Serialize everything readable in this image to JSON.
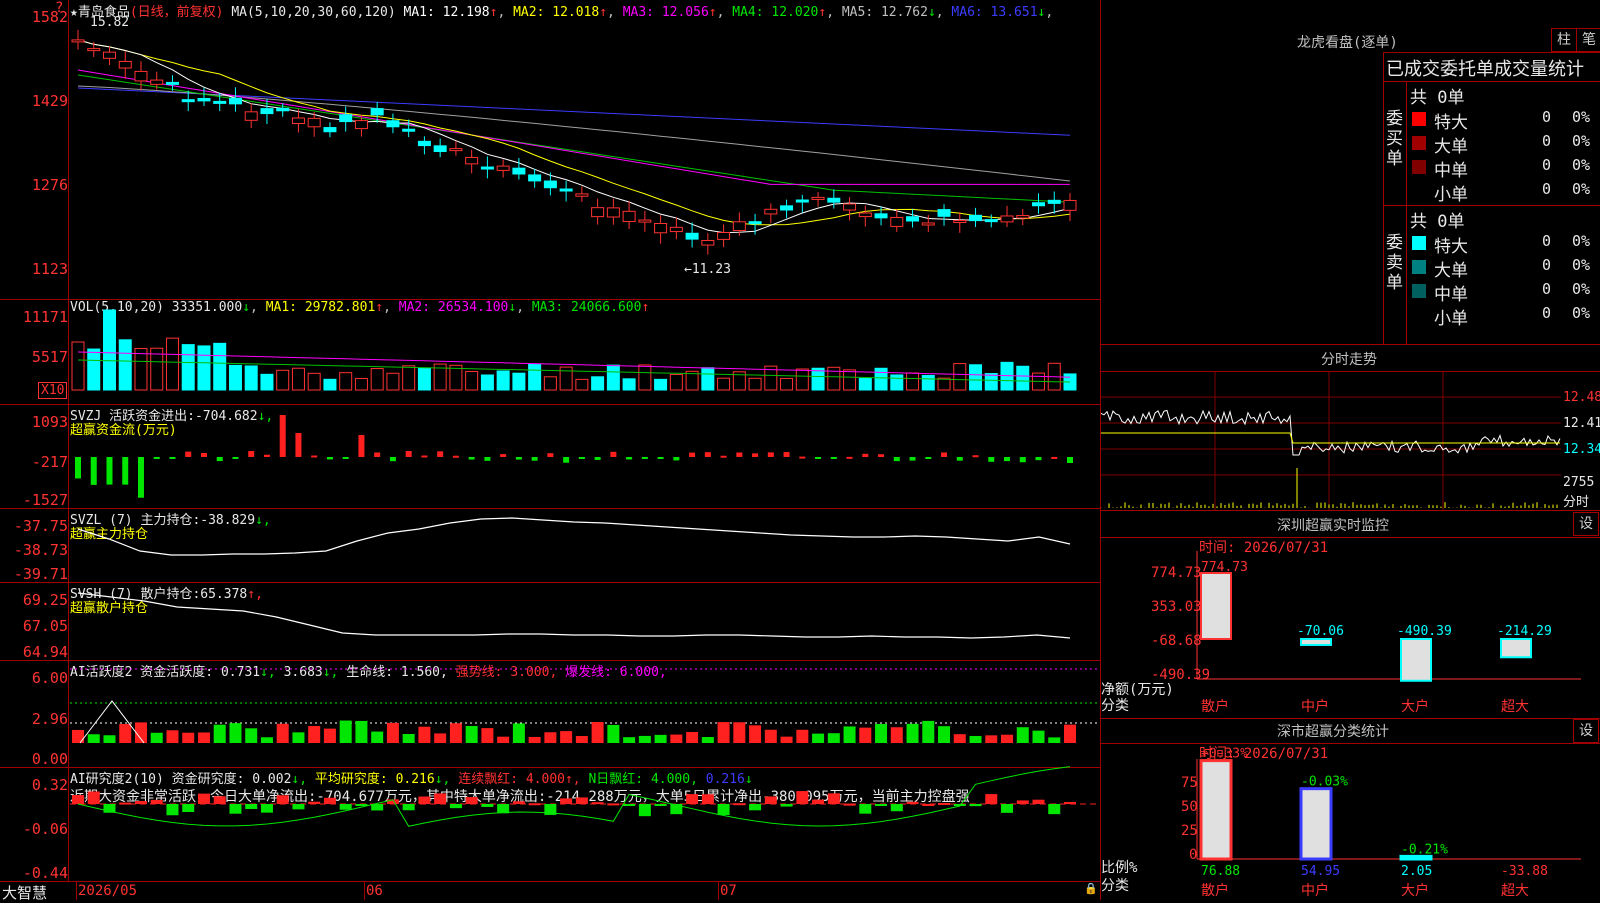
{
  "stock": {
    "star": "★",
    "name": "青岛食品",
    "mode": "(日线，前复权)",
    "ma_label": "MA(5,10,20,30,60,120)",
    "ma": [
      {
        "k": "MA1:",
        "v": "12.198",
        "c": "#ffffff"
      },
      {
        "k": "MA2:",
        "v": "12.018",
        "c": "#ffff00"
      },
      {
        "k": "MA3:",
        "v": "12.056",
        "c": "#ff00ff"
      },
      {
        "k": "MA4:",
        "v": "12.020",
        "c": "#00e600"
      },
      {
        "k": "MA5:",
        "v": "12.762",
        "c": "#c0c0c0"
      },
      {
        "k": "MA6:",
        "v": "13.651",
        "c": "#3c3cff"
      }
    ],
    "arrows": [
      "↑",
      "↑",
      "↑",
      "↑",
      "↓",
      "↓"
    ],
    "high_label": "15.82",
    "low_label": "←11.23",
    "question": "?"
  },
  "axes": {
    "price": [
      "1582",
      "1429",
      "1276",
      "1123"
    ],
    "vol": [
      "11171",
      "5517"
    ],
    "vol_unit": "X10",
    "svzj": [
      "1093",
      "-217",
      "-1527"
    ],
    "svzl": [
      "-37.75",
      "-38.73",
      "-39.71"
    ],
    "svsh": [
      "69.25",
      "67.05",
      "64.94"
    ],
    "ai": [
      "6.00",
      "2.96",
      "0.00"
    ],
    "ai2": [
      "0.32",
      "-0.06",
      "-0.44"
    ]
  },
  "vol_hdr": {
    "label": "VOL(5,10,20)",
    "v": "33351.000",
    "a": "↓",
    "ma1": "MA1:",
    "ma1v": "29782.801",
    "ma1a": "↑",
    "ma2": "MA2:",
    "ma2v": "26534.100",
    "ma2a": "↓",
    "ma3": "MA3:",
    "ma3v": "24066.600",
    "ma3a": "↑"
  },
  "svzj_hdr": {
    "label": "SVZJ  活跃资金进出:",
    "v": "-704.682",
    "a": "↓,",
    "sub": "超赢资金流(万元)"
  },
  "svzl_hdr": {
    "label": "SVZL (7) 主力持仓:",
    "v": "-38.829",
    "a": "↓,",
    "sub": "超赢主力持仓"
  },
  "svsh_hdr": {
    "label": "SVSH (7) 散户持仓:",
    "v": "65.378",
    "a": "↑,",
    "sub": "超赢散户持仓"
  },
  "ai_hdr": {
    "label": "AI活跃度2 资金活跃度:",
    "v": "0.731",
    "a": "↓,",
    "v2": "3.683",
    "a2": "↓,",
    "life": "生命线:",
    "lifev": "1.560,",
    "strong": "强势线:",
    "strongv": "3.000,",
    "burst": "爆发线:",
    "burstv": "6.000,"
  },
  "ai2_hdr": {
    "label": "AI研究度2(10) 资金研究度:",
    "v": "0.002",
    "a": "↓,",
    "avg": "平均研究度:",
    "avgv": "0.216",
    "avga": "↓,",
    "lian": "连续飘红:",
    "lianv": "4.000",
    "liana": "↑,",
    "n": "N日飘红:",
    "nv": "4.000,",
    "nv2": "0.216",
    "nva": "↓"
  },
  "ai2_text": "近期大资金非常活跃，今日大单净流出:-704.677万元，其中特大单净流出:-214.288万元，大单5日累计净出-380.095万元，当前主力控盘强",
  "dates": [
    "2026/05",
    "06",
    "07"
  ],
  "brand": "大智慧",
  "right": {
    "lhb_title": "龙虎看盘(逐单)",
    "btn_zhu": "柱",
    "btn_bi": "笔",
    "order_title": "已成交委托单成交量统计",
    "buy_label": "委买单",
    "sell_label": "委卖单",
    "buy_total": "共 0单",
    "sell_total": "共 0单",
    "buy_rows": [
      {
        "n": "特大",
        "q": "0",
        "p": "0%",
        "c": "#ff0000"
      },
      {
        "n": "大单",
        "q": "0",
        "p": "0%",
        "c": "#a00000"
      },
      {
        "n": "中单",
        "q": "0",
        "p": "0%",
        "c": "#800000"
      },
      {
        "n": "小单",
        "q": "0",
        "p": "0%",
        "c": "#000000"
      }
    ],
    "sell_rows": [
      {
        "n": "特大",
        "q": "0",
        "p": "0%",
        "c": "#00ffff"
      },
      {
        "n": "大单",
        "q": "0",
        "p": "0%",
        "c": "#008080"
      },
      {
        "n": "中单",
        "q": "0",
        "p": "0%",
        "c": "#006060"
      },
      {
        "n": "小单",
        "q": "0",
        "p": "0%",
        "c": "#000000"
      }
    ],
    "fs_title": "分时走势",
    "fs_axis": [
      "12.48",
      "12.41",
      "12.34",
      "2755",
      "分时"
    ],
    "mon_title": "深圳超赢实时监控",
    "set": "设",
    "mon_time": "时间: 2026/07/31",
    "mon_axis": [
      "774.73",
      "353.03",
      "-68.68",
      "-490.39"
    ],
    "mon_y_label": "净额(万元)",
    "mon_x_label": "分类",
    "mon_bars": [
      {
        "n": "散户",
        "v": "774.73",
        "val": 774.73,
        "c": "#ff3232"
      },
      {
        "n": "中户",
        "v": "-70.06",
        "val": -70.06,
        "c": "#00ffff"
      },
      {
        "n": "大户",
        "v": "-490.39",
        "val": -490.39,
        "c": "#00ffff"
      },
      {
        "n": "超大",
        "v": "-214.29",
        "val": -214.29,
        "c": "#00ffff"
      }
    ],
    "cls_title": "深市超赢分类统计",
    "cls_time": "时间: 2026/07/31",
    "cls_axis": [
      "75",
      "50",
      "25",
      "0"
    ],
    "cls_y_label": "比例%",
    "cls_x_label": "分类",
    "cls_bars": [
      {
        "n": "散户",
        "top": "+0.33%",
        "bot": "76.88",
        "val": 76.88,
        "c": "#ff3232"
      },
      {
        "n": "中户",
        "top": "-0.03%",
        "bot": "54.95",
        "val": 54.95,
        "c": "#3c3cff"
      },
      {
        "n": "大户",
        "top": "-0.21%",
        "bot": "2.05",
        "val": 2.05,
        "c": "#00ffff"
      },
      {
        "n": "超大",
        "top": "",
        "bot": "-33.88",
        "val": 0,
        "c": "#ff3232"
      }
    ]
  }
}
